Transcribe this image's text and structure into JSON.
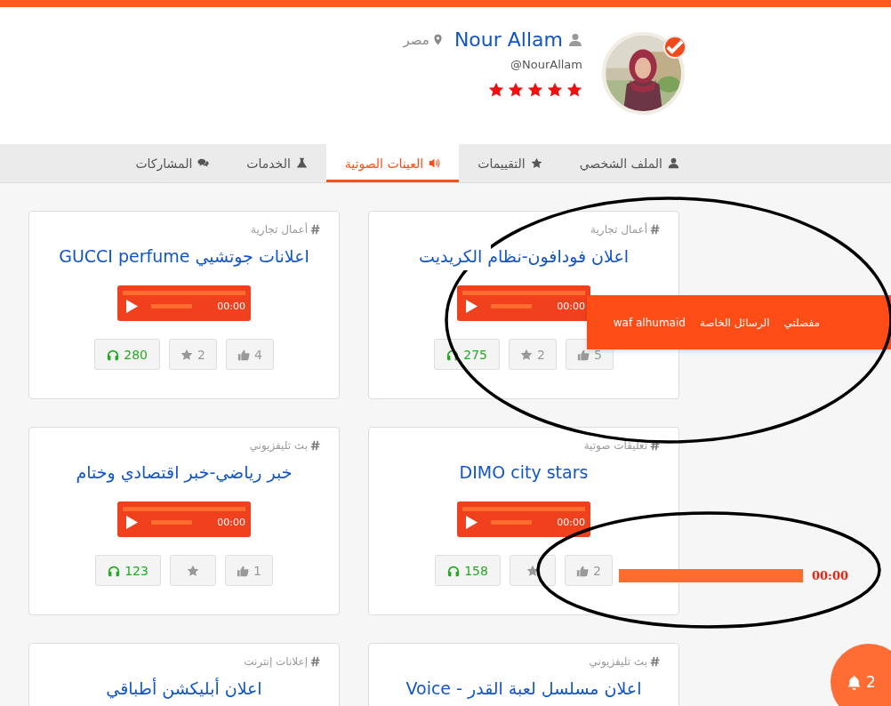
{
  "profile": {
    "name": "Nour Allam",
    "country": "مصر",
    "handle": "@NourAllam",
    "stars": 5,
    "verified": true
  },
  "tabs": [
    {
      "label": "الملف الشخصي",
      "selected": false
    },
    {
      "label": "التقييمات",
      "selected": false
    },
    {
      "label": "العينات الصوتية",
      "selected": true
    },
    {
      "label": "الخدمات",
      "selected": false
    },
    {
      "label": "المشاركات",
      "selected": false
    }
  ],
  "cards": [
    {
      "category": "أعمال تجارية",
      "title": "اعلان فودافون-نظام الكريديت",
      "player": {
        "time": "00:00"
      },
      "stats": {
        "likes": "5",
        "favorites": "2",
        "listens": "275"
      }
    },
    {
      "category": "أعمال تجارية",
      "title": "اعلانات جوتشيي GUCCI perfume",
      "player": {
        "time": "00:00"
      },
      "stats": {
        "likes": "4",
        "favorites": "2",
        "listens": "280"
      }
    },
    {
      "category": "تعليقات صوتية",
      "title": "DIMO city stars",
      "player": {
        "time": "00:00"
      },
      "stats": {
        "likes": "2",
        "listens": "158"
      }
    },
    {
      "category": "بث تليفزيوني",
      "title": "خبر رياضي-خبر اقتصادي وختام",
      "player": {
        "time": "00:00"
      },
      "stats": {
        "likes": "1",
        "listens": "123"
      }
    },
    {
      "category": "بث تليفزيوني",
      "title": "اعلان مسلسل لعبة القدر - Voice"
    },
    {
      "category": "إعلانات إنترنت",
      "title": "اعلان أبليكشن أطباقي"
    }
  ],
  "dropdown_menu": {
    "items": [
      "مفضلتي",
      "الرسائل الخاصة",
      "waf alhumaid"
    ]
  },
  "floating_player": {
    "time": "00:00"
  },
  "notifications": {
    "count": "2"
  },
  "annotations": [
    {
      "kind": "ellipse"
    },
    {
      "kind": "ellipse"
    }
  ]
}
